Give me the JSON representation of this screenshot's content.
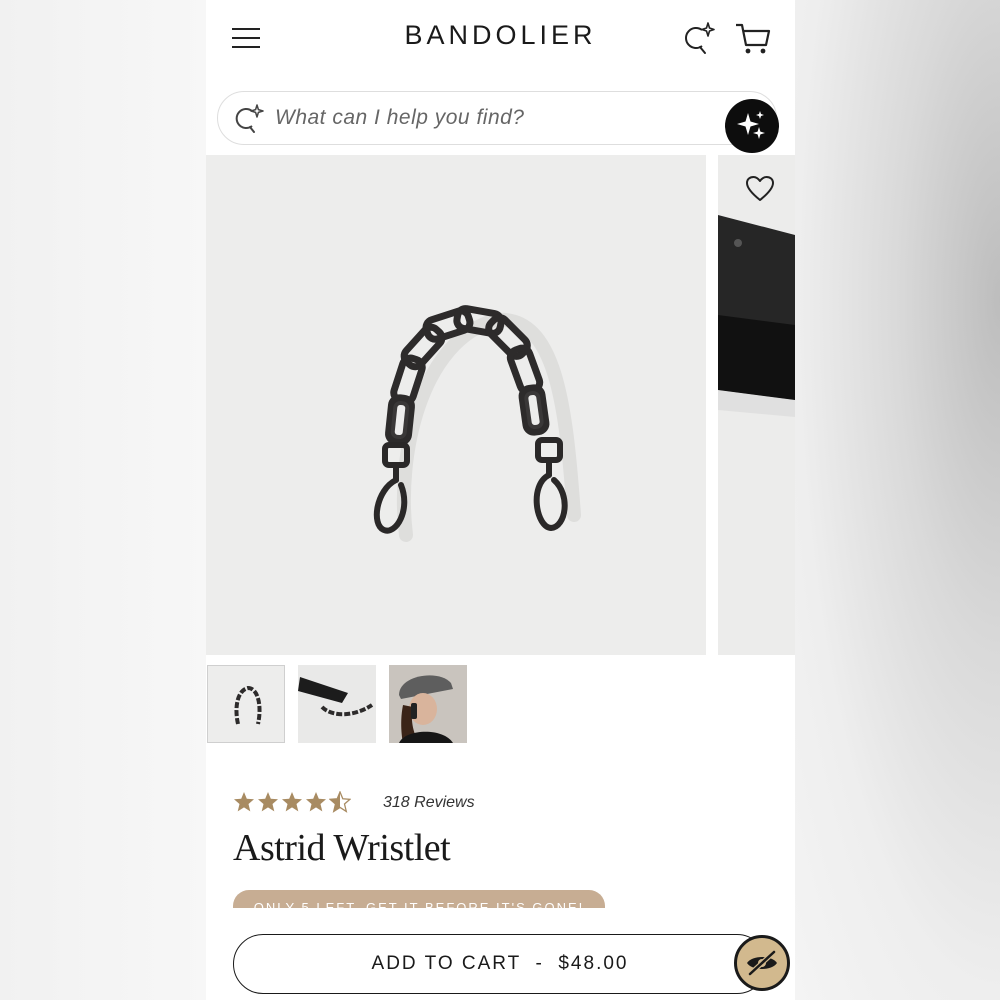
{
  "header": {
    "brand": "BANDOLIER",
    "menu_icon": "hamburger-menu-icon",
    "ai_search_icon": "sparkle-search-icon",
    "cart_icon": "shopping-cart-icon"
  },
  "search": {
    "placeholder": "What can I help you find?",
    "icon": "sparkle-search-icon",
    "assistant_icon": "sparkles-icon"
  },
  "gallery": {
    "wishlist_icon": "heart-icon",
    "thumbnails": [
      {
        "name": "chain-strap-photo",
        "active": true
      },
      {
        "name": "wristlet-with-chain-photo",
        "active": false
      },
      {
        "name": "model-photo",
        "active": false
      }
    ]
  },
  "product": {
    "rating": 4.5,
    "rating_max": 5,
    "reviews_text": "318 Reviews",
    "name": "Astrid Wristlet",
    "stock_message": "ONLY 5 LEFT. GET IT BEFORE IT'S GONE!",
    "add_to_cart_label": "ADD TO CART  -  $48.00"
  },
  "floating": {
    "accessibility_icon": "eye-slash-icon"
  },
  "colors": {
    "accent_tan": "#c7ad93",
    "star_gold": "#a88b62",
    "text_dark": "#1a1a1a"
  }
}
